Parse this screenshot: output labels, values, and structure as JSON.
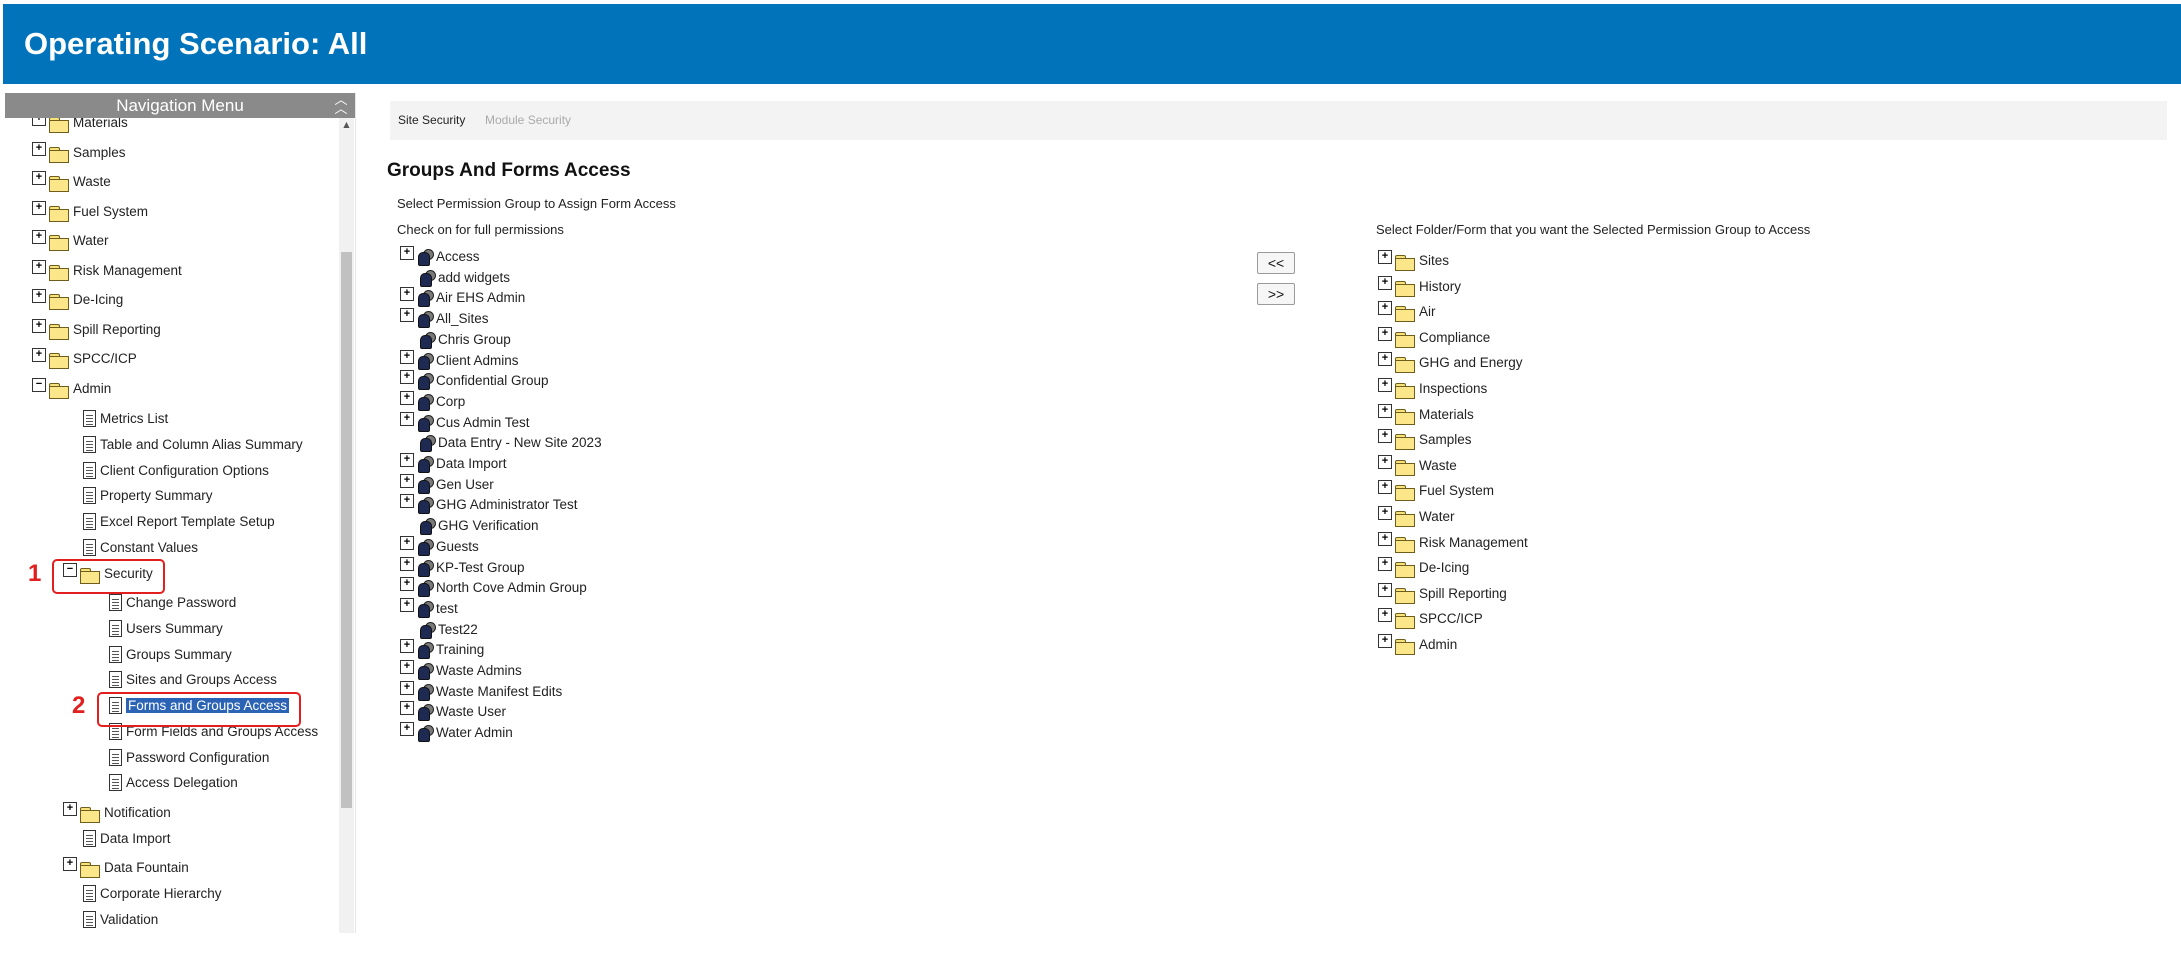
{
  "header": {
    "title": "Operating Scenario: All"
  },
  "nav": {
    "title": "Navigation Menu",
    "collapse_icon": "double-chevron-up-icon",
    "items": [
      {
        "label": "Materials",
        "kind": "folder",
        "expand": "+"
      },
      {
        "label": "Samples",
        "kind": "folder",
        "expand": "+"
      },
      {
        "label": "Waste",
        "kind": "folder",
        "expand": "+"
      },
      {
        "label": "Fuel System",
        "kind": "folder",
        "expand": "+"
      },
      {
        "label": "Water",
        "kind": "folder",
        "expand": "+"
      },
      {
        "label": "Risk Management",
        "kind": "folder",
        "expand": "+"
      },
      {
        "label": "De-Icing",
        "kind": "folder",
        "expand": "+"
      },
      {
        "label": "Spill Reporting",
        "kind": "folder",
        "expand": "+"
      },
      {
        "label": "SPCC/ICP",
        "kind": "folder",
        "expand": "+"
      },
      {
        "label": "Admin",
        "kind": "folder",
        "expand": "−"
      },
      {
        "label": "Metrics List",
        "kind": "doc"
      },
      {
        "label": "Table and Column Alias Summary",
        "kind": "doc"
      },
      {
        "label": "Client Configuration Options",
        "kind": "doc"
      },
      {
        "label": "Property Summary",
        "kind": "doc"
      },
      {
        "label": "Excel Report Template Setup",
        "kind": "doc"
      },
      {
        "label": "Constant Values",
        "kind": "doc"
      },
      {
        "label": "Security",
        "kind": "folder",
        "expand": "−"
      },
      {
        "label": "Change Password",
        "kind": "doc"
      },
      {
        "label": "Users Summary",
        "kind": "doc"
      },
      {
        "label": "Groups Summary",
        "kind": "doc"
      },
      {
        "label": "Sites and Groups Access",
        "kind": "doc"
      },
      {
        "label": "Forms and Groups Access",
        "kind": "doc",
        "selected": true
      },
      {
        "label": "Form Fields and Groups Access",
        "kind": "doc"
      },
      {
        "label": "Password Configuration",
        "kind": "doc"
      },
      {
        "label": "Access Delegation",
        "kind": "doc"
      },
      {
        "label": "Notification",
        "kind": "folder",
        "expand": "+"
      },
      {
        "label": "Data Import",
        "kind": "doc"
      },
      {
        "label": "Data Fountain",
        "kind": "folder",
        "expand": "+"
      },
      {
        "label": "Corporate Hierarchy",
        "kind": "doc"
      },
      {
        "label": "Validation",
        "kind": "doc"
      }
    ]
  },
  "annotations": {
    "step1": "1",
    "step2": "2",
    "color": "#e21f1f"
  },
  "tabs": [
    {
      "label": "Site Security",
      "active": true
    },
    {
      "label": "Module Security",
      "active": false
    }
  ],
  "main": {
    "title": "Groups And Forms Access",
    "instruction": "Select Permission Group to Assign Form Access",
    "left_header": "Check on for full permissions",
    "right_header": "Select Folder/Form that you want the Selected Permission Group to Access",
    "btn_add": "<<",
    "btn_remove": ">>"
  },
  "groups": [
    {
      "label": "Access",
      "expand": true
    },
    {
      "label": "add widgets",
      "expand": false
    },
    {
      "label": "Air EHS Admin",
      "expand": true
    },
    {
      "label": "All_Sites",
      "expand": true
    },
    {
      "label": "Chris Group",
      "expand": false
    },
    {
      "label": "Client Admins",
      "expand": true
    },
    {
      "label": "Confidential Group",
      "expand": true
    },
    {
      "label": "Corp",
      "expand": true
    },
    {
      "label": "Cus Admin Test",
      "expand": true
    },
    {
      "label": "Data Entry - New Site 2023",
      "expand": false
    },
    {
      "label": "Data Import",
      "expand": true
    },
    {
      "label": "Gen User",
      "expand": true
    },
    {
      "label": "GHG Administrator Test",
      "expand": true
    },
    {
      "label": "GHG Verification",
      "expand": false
    },
    {
      "label": "Guests",
      "expand": true
    },
    {
      "label": "KP-Test Group",
      "expand": true
    },
    {
      "label": "North Cove Admin Group",
      "expand": true
    },
    {
      "label": "test",
      "expand": true
    },
    {
      "label": "Test22",
      "expand": false
    },
    {
      "label": "Training",
      "expand": true
    },
    {
      "label": "Waste Admins",
      "expand": true
    },
    {
      "label": "Waste Manifest Edits",
      "expand": true
    },
    {
      "label": "Waste User",
      "expand": true
    },
    {
      "label": "Water Admin",
      "expand": true
    }
  ],
  "folders": [
    "Sites",
    "History",
    "Air",
    "Compliance",
    "GHG and Energy",
    "Inspections",
    "Materials",
    "Samples",
    "Waste",
    "Fuel System",
    "Water",
    "Risk Management",
    "De-Icing",
    "Spill Reporting",
    "SPCC/ICP",
    "Admin"
  ]
}
